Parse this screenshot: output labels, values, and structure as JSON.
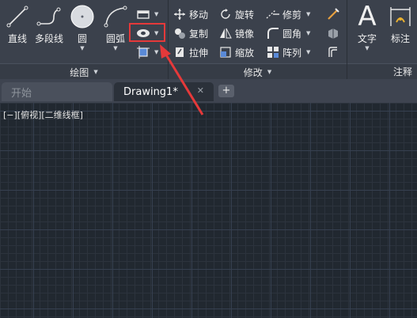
{
  "ribbon": {
    "draw_panel": {
      "title": "绘图",
      "line": "直线",
      "polyline": "多段线",
      "circle": "圆",
      "arc": "圆弧"
    },
    "modify_panel": {
      "title": "修改",
      "move": "移动",
      "rotate": "旋转",
      "trim": "修剪",
      "copy": "复制",
      "mirror": "镜像",
      "fillet": "圆角",
      "stretch": "拉伸",
      "scale": "缩放",
      "array": "阵列"
    },
    "annotation_panel": {
      "title": "注释",
      "text": "文字",
      "dimension": "标注"
    },
    "big_letter": "A"
  },
  "tabs": {
    "start": "开始",
    "drawing": "Drawing1*",
    "close": "✕",
    "add": "+"
  },
  "viewport": {
    "label": "[−][俯视][二维线框]"
  },
  "colors": {
    "highlight": "#e5393a",
    "canvas": "#212830",
    "ribbon": "#3b414c"
  }
}
